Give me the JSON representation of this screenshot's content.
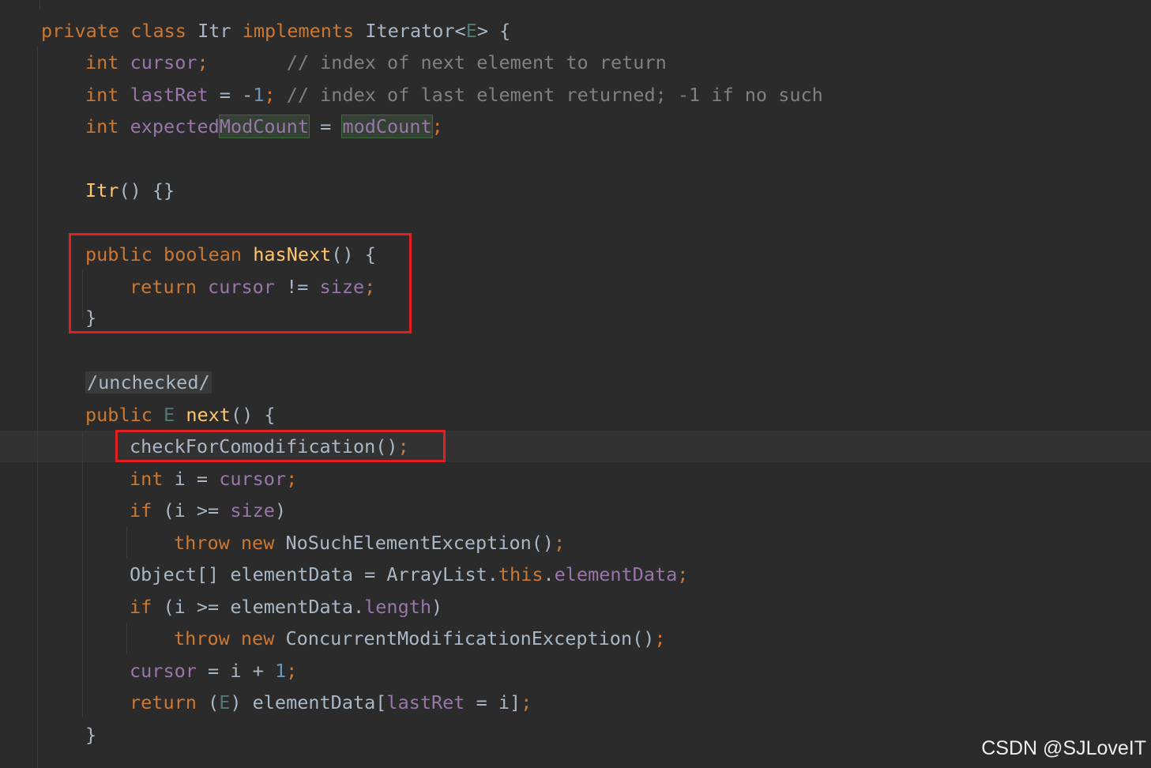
{
  "code": {
    "l1": {
      "kw_private": "private",
      "kw_class": "class",
      "name": "Itr",
      "kw_implements": "implements",
      "iface": "Iterator<",
      "type_param": "E",
      "close": "> {"
    },
    "l2": {
      "kw_int": "int",
      "field": "cursor",
      "semi": ";",
      "pad": "       ",
      "comment": "// index of next element to return"
    },
    "l3": {
      "kw_int": "int",
      "field": "lastRet",
      "op": " = -",
      "num": "1",
      "semi": ";",
      "comment": " // index of last element returned; -1 if no such"
    },
    "l4": {
      "kw_int": "int",
      "field_a": "expected",
      "field_b": "ModCount",
      "op": " = ",
      "field_c": "modCount",
      "semi": ";"
    },
    "l5": {
      "ctor": "Itr",
      "rest": "() {}"
    },
    "l6": {
      "kw_public": "public",
      "kw_boolean": "boolean",
      "method": "hasNext",
      "rest": "() {"
    },
    "l7": {
      "kw_return": "return",
      "field_a": "cursor",
      "op": " != ",
      "field_b": "size",
      "semi": ";"
    },
    "l8": {
      "brace": "}"
    },
    "l9": {
      "annotation": "/unchecked/"
    },
    "l10": {
      "kw_public": "public",
      "type_param": "E",
      "method": "next",
      "rest": "() {"
    },
    "l11": {
      "call": "checkForComodification()",
      "semi": ";"
    },
    "l12": {
      "kw_int": "int",
      "var": " i = ",
      "field": "cursor",
      "semi": ";"
    },
    "l13": {
      "kw_if": "if",
      "cond": " (i >= ",
      "field": "size",
      "close": ")"
    },
    "l14": {
      "kw_throw": "throw",
      "kw_new": "new",
      "ctor": " NoSuchElementException()",
      "semi": ";"
    },
    "l15": {
      "decl": "Object[] elementData = ArrayList.",
      "kw_this": "this",
      "dot": ".",
      "field": "elementData",
      "semi": ";"
    },
    "l16": {
      "kw_if": "if",
      "cond": " (i >= elementData.",
      "field": "length",
      "close": ")"
    },
    "l17": {
      "kw_throw": "throw",
      "kw_new": "new",
      "ctor": " ConcurrentModificationException()",
      "semi": ";"
    },
    "l18": {
      "field": "cursor",
      "op": " = i + ",
      "num": "1",
      "semi": ";"
    },
    "l19": {
      "kw_return": "return",
      "open": " (",
      "type_param": "E",
      "mid": ") elementData[",
      "field": "lastRet",
      "tail": " = i]",
      "semi": ";"
    },
    "l20": {
      "brace": "}"
    }
  },
  "watermark": "CSDN @SJLoveIT",
  "colors": {
    "background": "#2b2b2b",
    "keyword": "#cc7832",
    "field": "#9876aa",
    "method": "#ffc66d",
    "number": "#6897bb",
    "comment": "#808080",
    "highlight_box": "#e02020"
  }
}
